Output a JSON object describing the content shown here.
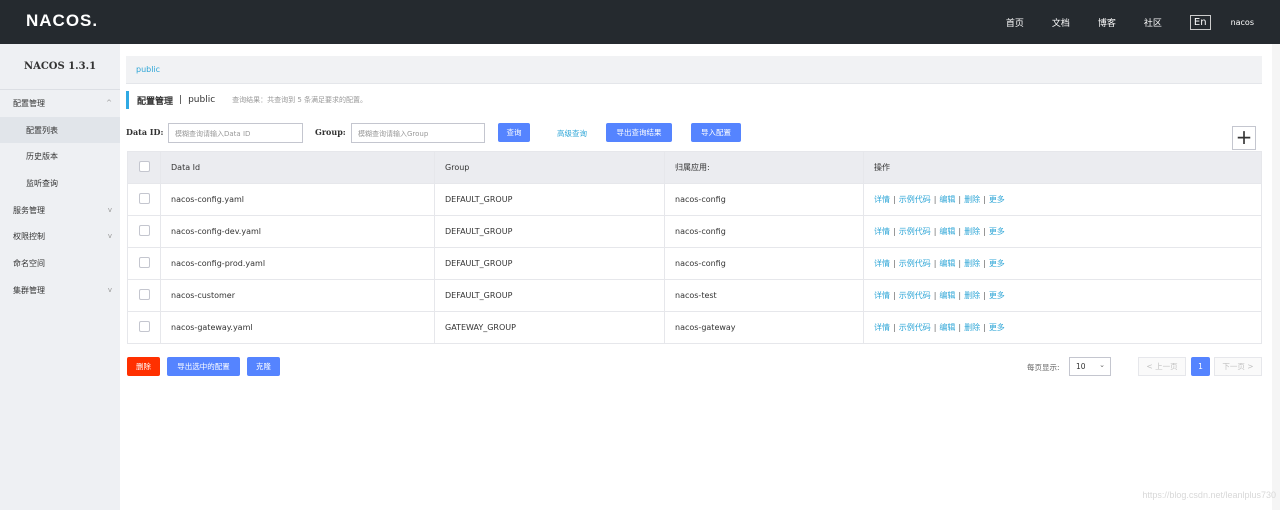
{
  "header": {
    "logo": "NACOS.",
    "nav": [
      "首页",
      "文档",
      "博客",
      "社区"
    ],
    "lang": "En",
    "user": "nacos"
  },
  "sidebar": {
    "version": "NACOS 1.3.1",
    "items": [
      {
        "label": "配置管理",
        "caret": "^"
      },
      {
        "label": "配置列表"
      },
      {
        "label": "历史版本"
      },
      {
        "label": "监听查询"
      },
      {
        "label": "服务管理",
        "caret": "v"
      },
      {
        "label": "权限控制",
        "caret": "v"
      },
      {
        "label": "命名空间"
      },
      {
        "label": "集群管理",
        "caret": "v"
      }
    ]
  },
  "main": {
    "breadcrumb": "public",
    "title": "配置管理",
    "separator": "|",
    "namespace": "public",
    "hint": "查询结果：共查询到 5 条满足要求的配置。",
    "search": {
      "dataid_label": "Data ID:",
      "dataid_placeholder": "模糊查询请输入Data ID",
      "group_label": "Group:",
      "group_placeholder": "模糊查询请输入Group",
      "query_btn": "查询",
      "advanced_link": "高级查询",
      "export_btn": "导出查询结果",
      "import_btn": "导入配置"
    },
    "table": {
      "headers": [
        "Data Id",
        "Group",
        "归属应用:",
        "操作"
      ],
      "ops": [
        "详情",
        "示例代码",
        "编辑",
        "删除",
        "更多"
      ],
      "rows": [
        {
          "dataid": "nacos-config.yaml",
          "group": "DEFAULT_GROUP",
          "app": "nacos-config"
        },
        {
          "dataid": "nacos-config-dev.yaml",
          "group": "DEFAULT_GROUP",
          "app": "nacos-config"
        },
        {
          "dataid": "nacos-config-prod.yaml",
          "group": "DEFAULT_GROUP",
          "app": "nacos-config"
        },
        {
          "dataid": "nacos-customer",
          "group": "DEFAULT_GROUP",
          "app": "nacos-test"
        },
        {
          "dataid": "nacos-gateway.yaml",
          "group": "GATEWAY_GROUP",
          "app": "nacos-gateway"
        }
      ]
    },
    "actions": {
      "delete": "删除",
      "export_selected": "导出选中的配置",
      "clone": "克隆"
    },
    "pager": {
      "per_page_label": "每页显示:",
      "per_page": "10",
      "prev": "< 上一页",
      "current": "1",
      "next": "下一页 >"
    }
  },
  "watermark": "https://blog.csdn.net/leanlplus730"
}
